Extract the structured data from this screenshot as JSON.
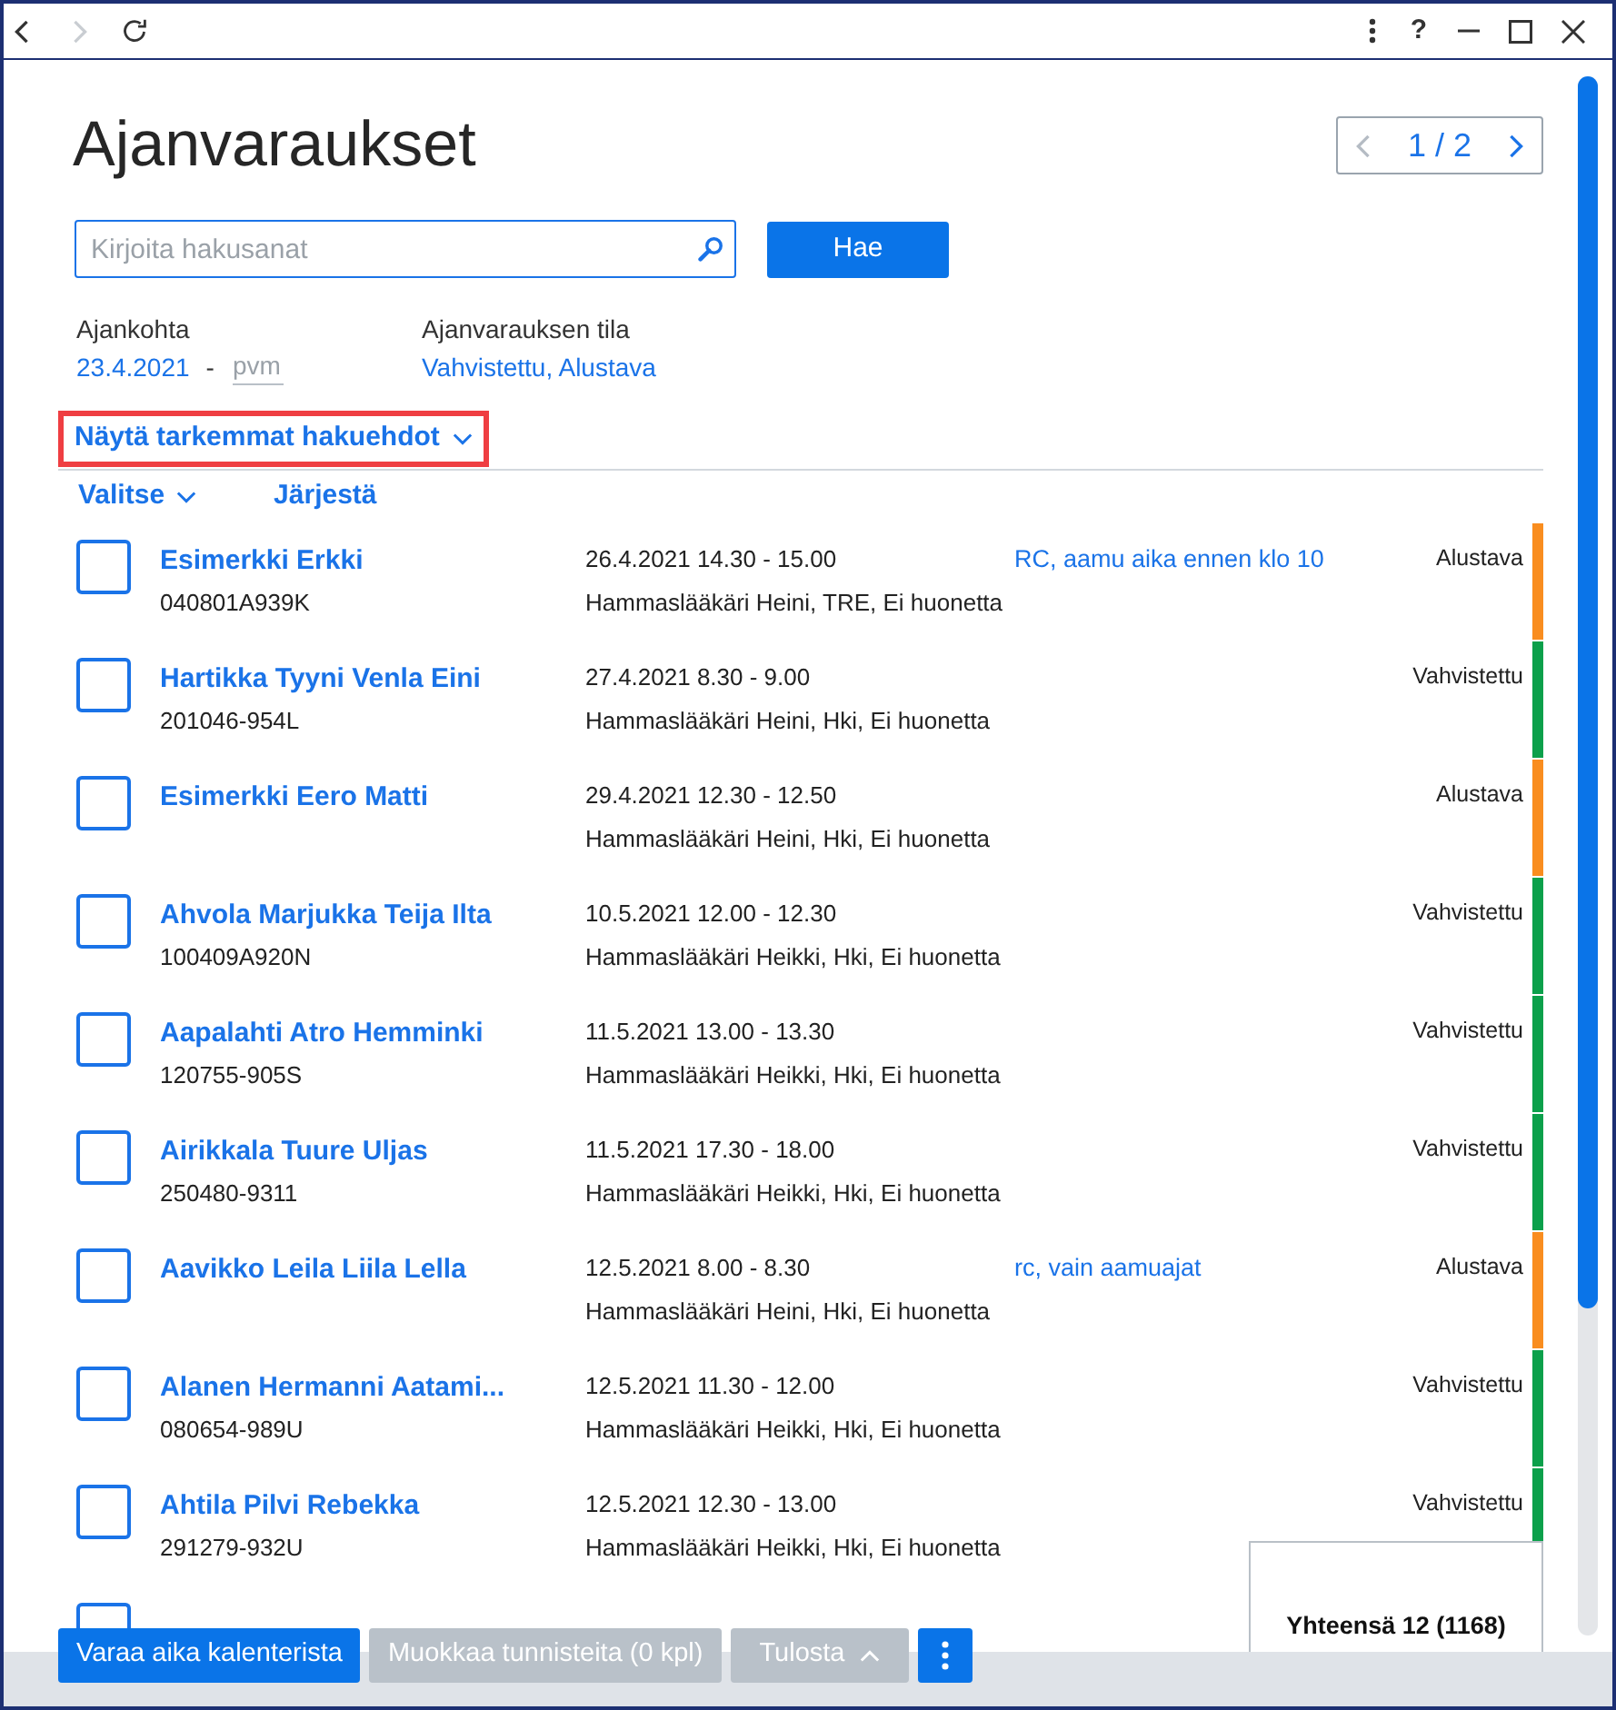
{
  "window": {
    "nav": [
      {
        "kind": "back",
        "disabled": false
      },
      {
        "kind": "forward",
        "disabled": true
      },
      {
        "kind": "reload",
        "disabled": false
      }
    ],
    "help": "?"
  },
  "title": "Ajanvaraukset",
  "pager": {
    "label": "1 / 2",
    "prev_disabled": true,
    "next_disabled": false
  },
  "search": {
    "placeholder": "Kirjoita hakusanat",
    "button": "Hae"
  },
  "filters": {
    "date": {
      "label": "Ajankohta",
      "from": "23.4.2021",
      "separator": "-",
      "to_placeholder": "pvm"
    },
    "status": {
      "label": "Ajanvarauksen tila",
      "value": "Vahvistettu, Alustava"
    }
  },
  "more_filters": {
    "label": "Näytä tarkemmat hakuehdot",
    "expanded": false,
    "highlighted": true
  },
  "list_actions": [
    {
      "kind": "dropdown",
      "label": "Valitse"
    },
    {
      "kind": "link",
      "label": "Järjestä"
    }
  ],
  "appointments": [
    {
      "name": "Esimerkki Erkki",
      "id": "040801A939K",
      "time": "26.4.2021 14.30 - 15.00",
      "provider": "Hammaslääkäri Heini, TRE, Ei huonetta",
      "note": "RC, aamu aika ennen klo 10",
      "status": "Alustava",
      "color": "#f98d1f",
      "selected": false
    },
    {
      "name": "Hartikka Tyyni Venla Eini",
      "id": "201046-954L",
      "time": "27.4.2021 8.30 - 9.00",
      "provider": "Hammaslääkäri Heini, Hki, Ei huonetta",
      "status": "Vahvistettu",
      "color": "#0ca04b",
      "selected": false
    },
    {
      "name": "Esimerkki Eero Matti",
      "time": "29.4.2021 12.30 - 12.50",
      "provider": "Hammaslääkäri Heini, Hki, Ei huonetta",
      "status": "Alustava",
      "color": "#f98d1f",
      "selected": false
    },
    {
      "name": "Ahvola Marjukka Teija Ilta",
      "id": "100409A920N",
      "time": "10.5.2021 12.00 - 12.30",
      "provider": "Hammaslääkäri Heikki, Hki, Ei huonetta",
      "status": "Vahvistettu",
      "color": "#0ca04b",
      "selected": false
    },
    {
      "name": "Aapalahti Atro Hemminki",
      "id": "120755-905S",
      "time": "11.5.2021 13.00 - 13.30",
      "provider": "Hammaslääkäri Heikki, Hki, Ei huonetta",
      "status": "Vahvistettu",
      "color": "#0ca04b",
      "selected": false
    },
    {
      "name": "Airikkala Tuure Uljas",
      "id": "250480-9311",
      "time": "11.5.2021 17.30 - 18.00",
      "provider": "Hammaslääkäri Heikki, Hki, Ei huonetta",
      "status": "Vahvistettu",
      "color": "#0ca04b",
      "selected": false
    },
    {
      "name": "Aavikko Leila Liila Lella",
      "time": "12.5.2021 8.00 - 8.30",
      "provider": "Hammaslääkäri Heini, Hki, Ei huonetta",
      "note": "rc, vain aamuajat",
      "status": "Alustava",
      "color": "#f98d1f",
      "selected": false
    },
    {
      "name": "Alanen Hermanni Aatami...",
      "id": "080654-989U",
      "time": "12.5.2021 11.30 - 12.00",
      "provider": "Hammaslääkäri Heikki, Hki, Ei huonetta",
      "status": "Vahvistettu",
      "color": "#0ca04b",
      "selected": false
    },
    {
      "name": "Ahtila Pilvi Rebekka",
      "id": "291279-932U",
      "time": "12.5.2021 12.30 - 13.00",
      "provider": "Hammaslääkäri Heikki, Hki, Ei huonetta",
      "status": "Vahvistettu",
      "color": "#0ca04b",
      "selected": false
    },
    {
      "selected": false
    }
  ],
  "footer": {
    "buttons": [
      {
        "kind": "text",
        "label": "Varaa aika kalenterista",
        "disabled": false
      },
      {
        "kind": "text",
        "label": "Muokkaa tunnisteita (0 kpl)",
        "disabled": true
      },
      {
        "kind": "menu",
        "label": "Tulosta",
        "disabled": true
      },
      {
        "kind": "more",
        "disabled": false
      }
    ],
    "total": "Yhteensä 12 (1168)"
  }
}
